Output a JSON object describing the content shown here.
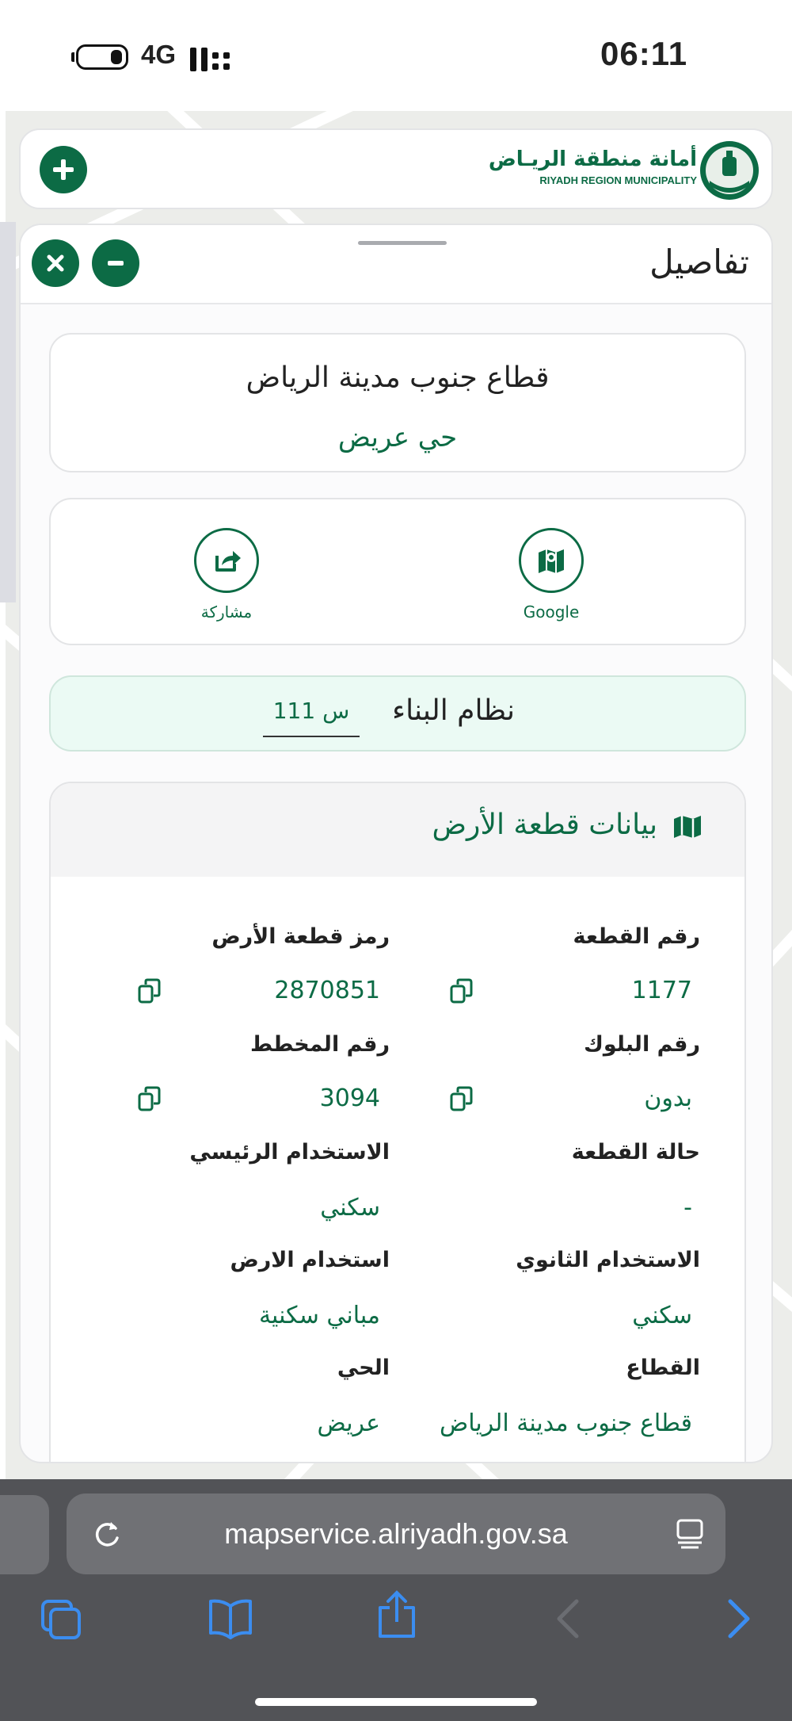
{
  "status_bar": {
    "network": "4G",
    "time": "06:11"
  },
  "header": {
    "logo_ar": "أمانة منطقة الريـاض",
    "logo_en": "RIYADH REGION MUNICIPALITY"
  },
  "panel": {
    "title": "تفاصيل",
    "location": {
      "sector": "قطاع جنوب مدينة الرياض",
      "district": "حي عريض"
    },
    "actions": {
      "google_label": "Google",
      "share_label": "مشاركة"
    },
    "building_system": {
      "label": "نظام البناء",
      "value": "س 111"
    },
    "land_data": {
      "title": "بيانات قطعة الأرض",
      "fields": {
        "plot_number": {
          "label": "رقم القطعة",
          "value": "1177"
        },
        "plot_code": {
          "label": "رمز قطعة الأرض",
          "value": "2870851"
        },
        "block_number": {
          "label": "رقم البلوك",
          "value": "بدون"
        },
        "plan_number": {
          "label": "رقم المخطط",
          "value": "3094"
        },
        "plot_status": {
          "label": "حالة القطعة",
          "value": "-"
        },
        "main_use": {
          "label": "الاستخدام الرئيسي",
          "value": "سكني"
        },
        "secondary_use": {
          "label": "الاستخدام الثانوي",
          "value": "سكني"
        },
        "land_use": {
          "label": "استخدام الارض",
          "value": "مباني سكنية"
        },
        "sector": {
          "label": "القطاع",
          "value": "قطاع جنوب مدينة الرياض"
        },
        "district": {
          "label": "الحي",
          "value": "عريض"
        }
      }
    }
  },
  "browser": {
    "url": "mapservice.alriyadh.gov.sa"
  },
  "colors": {
    "brand_green": "#0c6b45",
    "building_bg": "#ebfaf4",
    "browser_bg": "#525357",
    "browser_accent": "#3b8df0"
  }
}
